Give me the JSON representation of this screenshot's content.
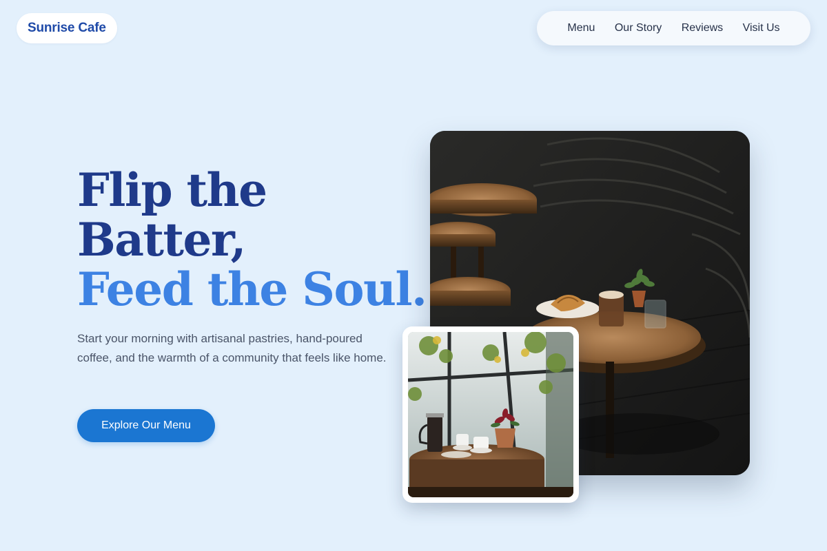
{
  "brand": {
    "name": "Sunrise Cafe"
  },
  "nav": {
    "items": [
      "Menu",
      "Our Story",
      "Reviews",
      "Visit Us"
    ]
  },
  "hero": {
    "headline_line1": "Flip the",
    "headline_line2": "Batter,",
    "headline_line3": "Feed the Soul.",
    "subtext": "Start your morning with artisanal pastries, hand-poured coffee, and the warmth of a community that feels like home.",
    "cta_label": "Explore Our Menu"
  },
  "images": {
    "main_alt": "Cafe tables with croissant and latte",
    "small_alt": "Window table with French press and coffee cup"
  },
  "colors": {
    "background": "#e3f0fc",
    "brand_text": "#1f4aa8",
    "headline_dark": "#1f3a8a",
    "headline_accent": "#3d82e3",
    "cta": "#1b76d2"
  }
}
